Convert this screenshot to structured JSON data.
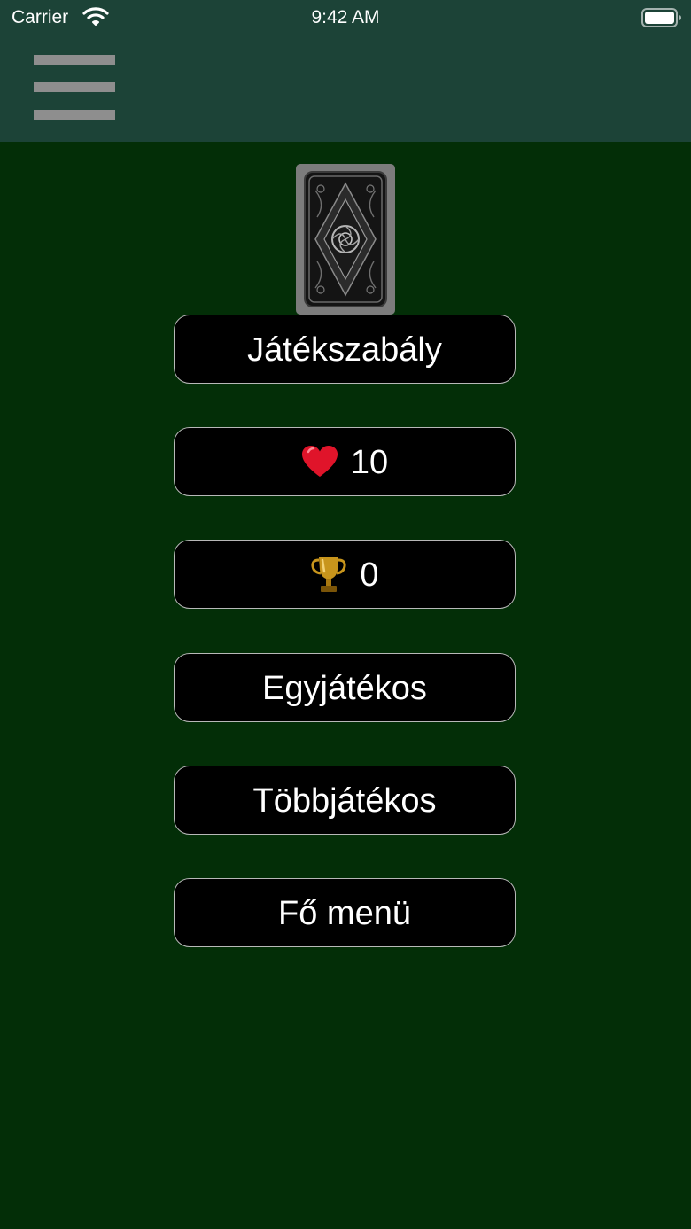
{
  "status_bar": {
    "carrier": "Carrier",
    "time": "9:42 AM",
    "wifi_icon": "wifi-icon",
    "battery_icon": "battery-full-icon"
  },
  "header": {
    "menu_icon": "hamburger-menu-icon"
  },
  "deck": {
    "icon": "card-back-icon"
  },
  "menu": {
    "rules_label": "Játékszabály",
    "lives_value": "10",
    "lives_icon": "heart-icon",
    "trophies_value": "0",
    "trophies_icon": "trophy-icon",
    "single_player_label": "Egyjátékos",
    "multiplayer_label": "Többjátékos",
    "main_menu_label": "Fő menü"
  },
  "colors": {
    "background": "#032e07",
    "header": "#1c4337",
    "button_bg": "#000000",
    "button_border": "#b8b8b8",
    "heart": "#e0142a",
    "trophy": "#c8951c"
  }
}
